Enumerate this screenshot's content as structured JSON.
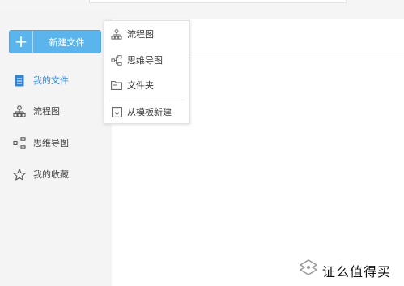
{
  "toolbar": {
    "new_file_label": "新建文件",
    "plus_symbol": "+"
  },
  "sidebar": {
    "items": [
      {
        "label": "我的文件",
        "icon": "document-icon",
        "active": true
      },
      {
        "label": "流程图",
        "icon": "flowchart-icon"
      },
      {
        "label": "思维导图",
        "icon": "mindmap-icon"
      },
      {
        "label": "我的收藏",
        "icon": "star-icon"
      }
    ]
  },
  "new_menu": {
    "items": [
      {
        "label": "流程图",
        "icon": "flowchart-icon"
      },
      {
        "label": "思维导图",
        "icon": "mindmap-icon"
      },
      {
        "label": "文件夹",
        "icon": "folder-icon"
      },
      {
        "label": "从模板新建",
        "icon": "template-icon"
      }
    ]
  },
  "watermark": {
    "text": "证么值得买"
  },
  "colors": {
    "accent": "#5bb5ec",
    "active_text": "#2f86d6",
    "sidebar_bg": "#f4f4f4"
  }
}
